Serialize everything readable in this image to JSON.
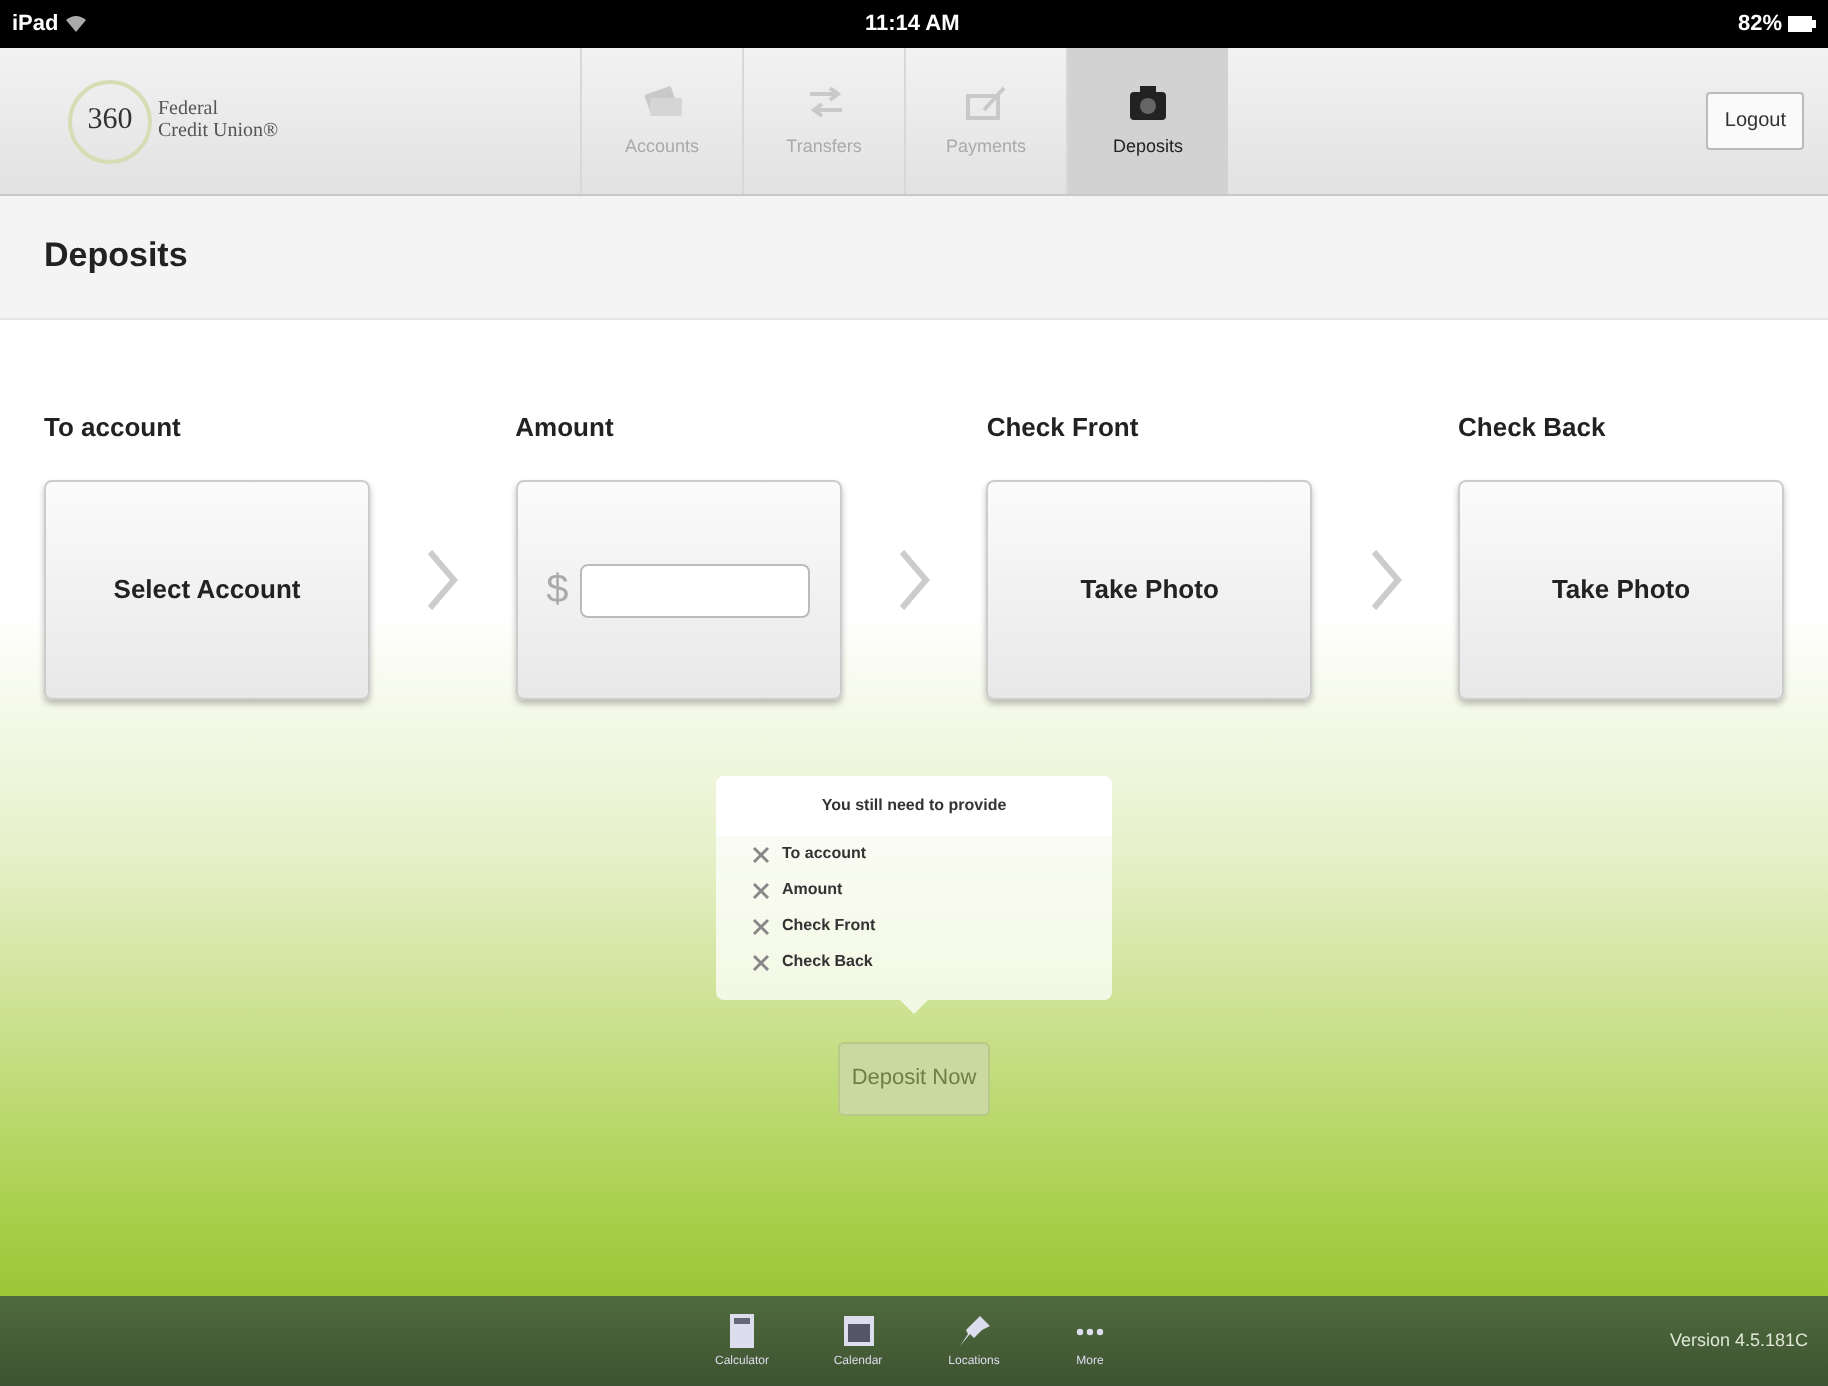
{
  "status_bar": {
    "device": "iPad",
    "time": "11:14 AM",
    "battery": "82%"
  },
  "header": {
    "logo": {
      "number": "360",
      "line_1": "Federal",
      "line_2": "Credit Union®"
    },
    "tabs": [
      {
        "label": "Accounts",
        "selected": false
      },
      {
        "label": "Transfers",
        "selected": false
      },
      {
        "label": "Payments",
        "selected": false
      },
      {
        "label": "Deposits",
        "selected": true
      }
    ],
    "logout": "Logout"
  },
  "page_title": "Deposits",
  "steps": [
    {
      "label": "To account",
      "kind": "select",
      "action": "Select Account"
    },
    {
      "label": "Amount",
      "kind": "amount",
      "currency": "$"
    },
    {
      "label": "Check Front",
      "kind": "photo",
      "action": "Take Photo"
    },
    {
      "label": "Check Back",
      "kind": "photo",
      "action": "Take Photo"
    }
  ],
  "missing": {
    "title": "You still need to provide",
    "items": [
      "To account",
      "Amount",
      "Check Front",
      "Check Back"
    ]
  },
  "deposit_button": {
    "label": "Deposit Now",
    "disabled": true
  },
  "footer": {
    "tools": [
      {
        "label": "Calculator"
      },
      {
        "label": "Calendar"
      },
      {
        "label": "Locations"
      },
      {
        "label": "More"
      }
    ],
    "version": "Version 4.5.181C"
  }
}
